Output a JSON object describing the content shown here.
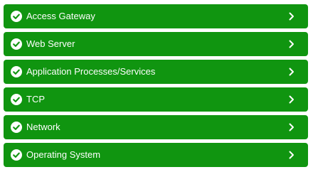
{
  "colors": {
    "row_background": "#109510",
    "text": "#ffffff",
    "page_background": "#ffffff"
  },
  "status_list": {
    "items": [
      {
        "label": "Access Gateway",
        "status_icon": "check-circle-icon",
        "action_icon": "chevron-right-icon"
      },
      {
        "label": "Web Server",
        "status_icon": "check-circle-icon",
        "action_icon": "chevron-right-icon"
      },
      {
        "label": "Application Processes/Services",
        "status_icon": "check-circle-icon",
        "action_icon": "chevron-right-icon"
      },
      {
        "label": "TCP",
        "status_icon": "check-circle-icon",
        "action_icon": "chevron-right-icon"
      },
      {
        "label": "Network",
        "status_icon": "check-circle-icon",
        "action_icon": "chevron-right-icon"
      },
      {
        "label": "Operating System",
        "status_icon": "check-circle-icon",
        "action_icon": "chevron-right-icon"
      }
    ]
  }
}
